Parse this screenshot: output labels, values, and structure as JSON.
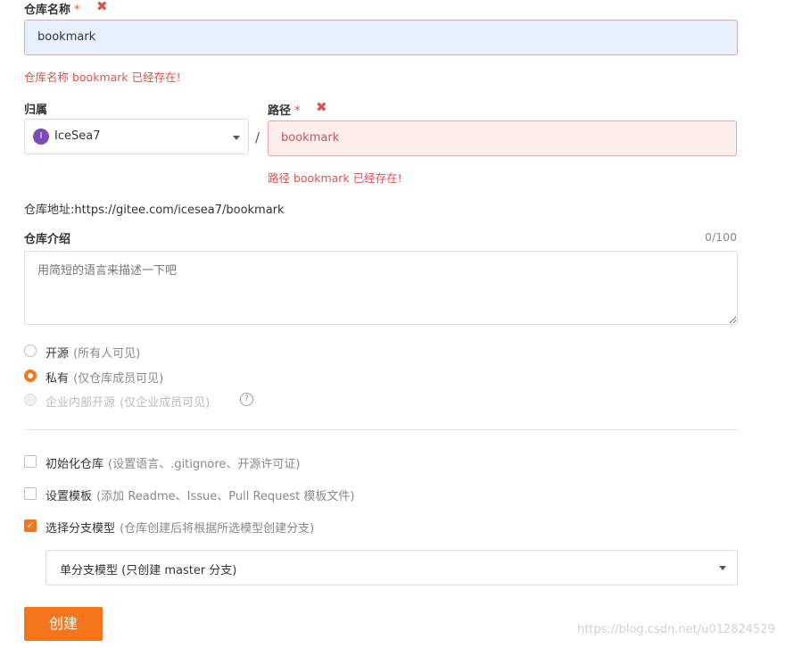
{
  "repo_name": {
    "label": "仓库名称",
    "required_mark": "*",
    "value": "bookmark",
    "error": "仓库名称 bookmark 已经存在!"
  },
  "owner": {
    "label": "归属",
    "avatar_letter": "I",
    "value": "IceSea7",
    "separator": "/"
  },
  "path": {
    "label": "路径",
    "required_mark": "*",
    "value": "bookmark",
    "error": "路径 bookmark 已经存在!"
  },
  "address": {
    "label": "仓库地址:",
    "url": "https://gitee.com/icesea7/bookmark"
  },
  "description": {
    "label": "仓库介绍",
    "counter": "0/100",
    "placeholder": "用简短的语言来描述一下吧"
  },
  "visibility": {
    "options": [
      {
        "label": "开源",
        "hint": "(所有人可见)",
        "checked": false,
        "disabled": false
      },
      {
        "label": "私有",
        "hint": "(仅仓库成员可见)",
        "checked": true,
        "disabled": false
      },
      {
        "label": "企业内部开源",
        "hint": "(仅企业成员可见)",
        "checked": false,
        "disabled": true
      }
    ]
  },
  "options": [
    {
      "label": "初始化仓库",
      "hint": "(设置语言、.gitignore、开源许可证)",
      "checked": false
    },
    {
      "label": "设置模板",
      "hint": "(添加 Readme、Issue、Pull Request 模板文件)",
      "checked": false
    },
    {
      "label": "选择分支模型",
      "hint": "(仓库创建后将根据所选模型创建分支)",
      "checked": true
    }
  ],
  "branch_model": {
    "value": "单分支模型 (只创建 master 分支)"
  },
  "submit": {
    "label": "创建"
  },
  "watermark": "https://blog.csdn.net/u012824529",
  "colors": {
    "accent": "#f5751e",
    "error": "#d9534f"
  }
}
